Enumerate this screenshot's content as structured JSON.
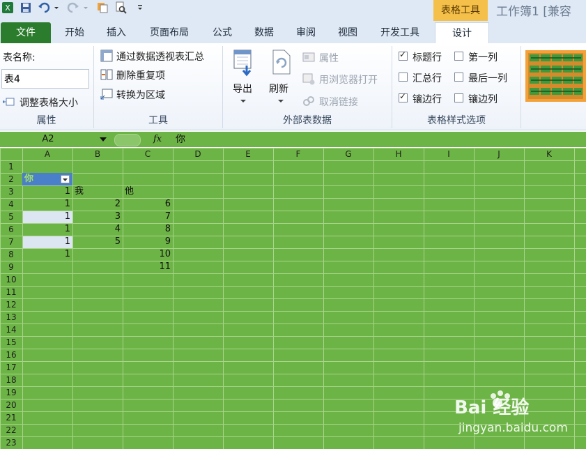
{
  "quick_access": {
    "icons": [
      "excel-logo-icon",
      "save-icon",
      "undo-icon",
      "redo-icon",
      "copy-icon",
      "print-preview-icon",
      "customize-icon"
    ]
  },
  "context_tab": "表格工具",
  "doc_title": "工作簿1  [兼容",
  "tabs": [
    "文件",
    "开始",
    "插入",
    "页面布局",
    "公式",
    "数据",
    "审阅",
    "视图",
    "开发工具",
    "设计"
  ],
  "ribbon": {
    "properties": {
      "table_name_label": "表名称:",
      "table_name_value": "表4",
      "resize_label": "调整表格大小",
      "group_label": "属性"
    },
    "tools": {
      "pivot_label": "通过数据透视表汇总",
      "remove_dup_label": "删除重复项",
      "convert_label": "转换为区域",
      "group_label": "工具"
    },
    "external": {
      "export_label": "导出",
      "refresh_label": "刷新",
      "props_label": "属性",
      "browser_label": "用浏览器打开",
      "unlink_label": "取消链接",
      "group_label": "外部表数据"
    },
    "style_options": {
      "header_row": {
        "label": "标题行",
        "checked": true
      },
      "first_col": {
        "label": "第一列",
        "checked": false
      },
      "total_row": {
        "label": "汇总行",
        "checked": false
      },
      "last_col": {
        "label": "最后一列",
        "checked": false
      },
      "banded_rows": {
        "label": "镶边行",
        "checked": true
      },
      "banded_cols": {
        "label": "镶边列",
        "checked": false
      },
      "group_label": "表格样式选项"
    }
  },
  "formula_bar": {
    "name_box": "A2",
    "fx": "fx",
    "content": "你"
  },
  "sheet": {
    "columns": [
      "A",
      "B",
      "C",
      "D",
      "E",
      "F",
      "G",
      "H",
      "I",
      "J",
      "K"
    ],
    "rows": [
      "1",
      "2",
      "3",
      "4",
      "5",
      "6",
      "7",
      "8",
      "9",
      "10",
      "11",
      "12",
      "13",
      "14",
      "15",
      "16",
      "17",
      "18",
      "19",
      "20",
      "21",
      "22",
      "23"
    ],
    "header_cell": "你",
    "cells": [
      {
        "ref": "A3",
        "text": "1",
        "align": "right"
      },
      {
        "ref": "B3",
        "text": "我",
        "align": "left"
      },
      {
        "ref": "C3",
        "text": "他",
        "align": "left"
      },
      {
        "ref": "A4",
        "text": "1",
        "align": "right"
      },
      {
        "ref": "B4",
        "text": "2",
        "align": "right"
      },
      {
        "ref": "C4",
        "text": "6",
        "align": "right"
      },
      {
        "ref": "A5",
        "text": "1",
        "align": "right"
      },
      {
        "ref": "B5",
        "text": "3",
        "align": "right"
      },
      {
        "ref": "C5",
        "text": "7",
        "align": "right"
      },
      {
        "ref": "A6",
        "text": "1",
        "align": "right"
      },
      {
        "ref": "B6",
        "text": "4",
        "align": "right"
      },
      {
        "ref": "C6",
        "text": "8",
        "align": "right"
      },
      {
        "ref": "A7",
        "text": "1",
        "align": "right"
      },
      {
        "ref": "B7",
        "text": "5",
        "align": "right"
      },
      {
        "ref": "C7",
        "text": "9",
        "align": "right"
      },
      {
        "ref": "A8",
        "text": "1",
        "align": "right"
      },
      {
        "ref": "C8",
        "text": "10",
        "align": "right"
      },
      {
        "ref": "C9",
        "text": "11",
        "align": "right"
      }
    ]
  },
  "watermark": {
    "brand": "Bai 经验",
    "url": "jingyan.baidu.com"
  },
  "colors": {
    "sheet_bg": "#6db446",
    "grid_line": "#a9d48c",
    "file_tab": "#2c7c2e",
    "context_tab": "#f5c04a",
    "selected_cell": "#4a7fc9",
    "band_row": "#dce6f2"
  }
}
